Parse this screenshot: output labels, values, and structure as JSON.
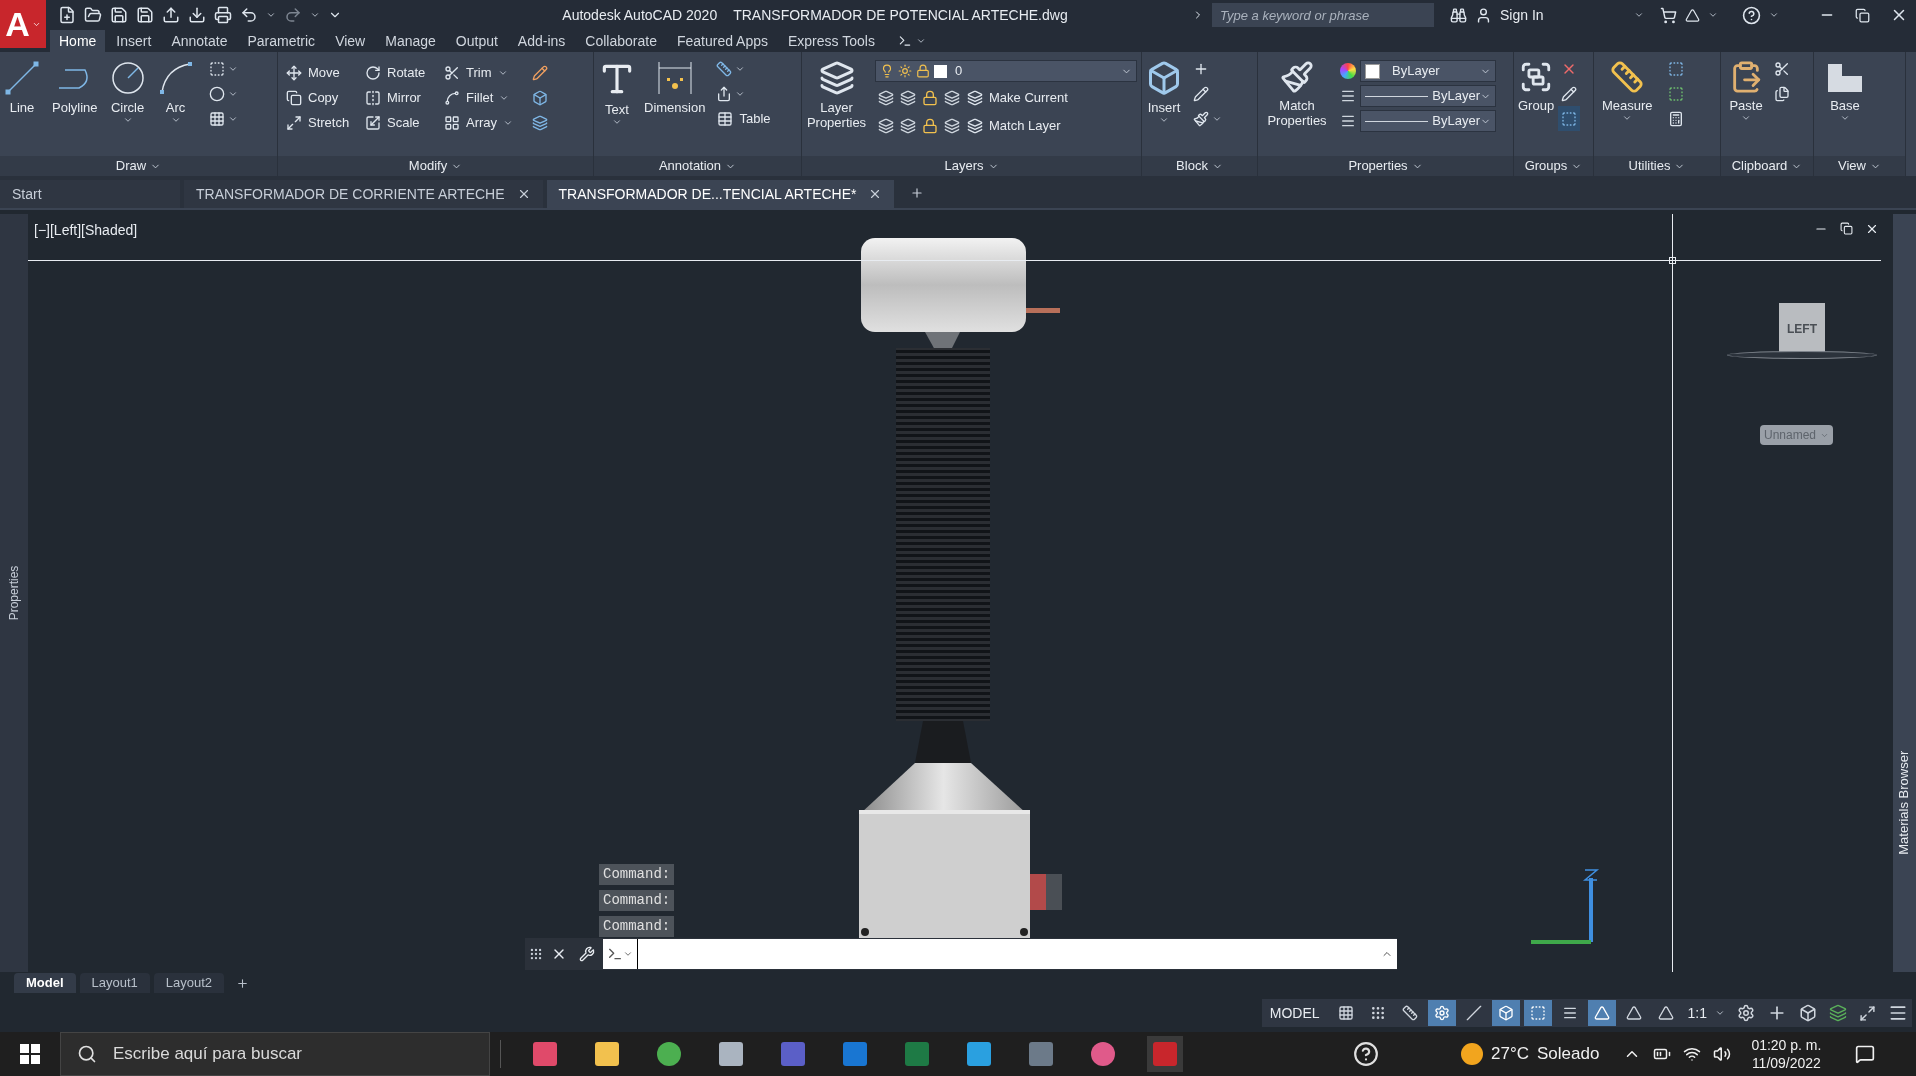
{
  "app_button": {
    "logo": "A"
  },
  "title_bar": {
    "app_title": "Autodesk AutoCAD 2020",
    "file_title": "TRANSFORMADOR DE POTENCIAL ARTECHE.dwg",
    "search": {
      "placeholder": "Type a keyword or phrase"
    },
    "sign_in": "Sign In"
  },
  "ribbon_tabs": [
    {
      "label": "Home",
      "selected": true
    },
    {
      "label": "Insert",
      "selected": false
    },
    {
      "label": "Annotate",
      "selected": false
    },
    {
      "label": "Parametric",
      "selected": false
    },
    {
      "label": "View",
      "selected": false
    },
    {
      "label": "Manage",
      "selected": false
    },
    {
      "label": "Output",
      "selected": false
    },
    {
      "label": "Add-ins",
      "selected": false
    },
    {
      "label": "Collaborate",
      "selected": false
    },
    {
      "label": "Featured Apps",
      "selected": false
    },
    {
      "label": "Express Tools",
      "selected": false
    }
  ],
  "ribbon_panels": [
    {
      "title": "Draw",
      "large": [
        "Line",
        "Polyline",
        "Circle",
        "Arc"
      ]
    },
    {
      "title": "Modify",
      "small": [
        "Move",
        "Rotate",
        "Trim",
        "Copy",
        "Mirror",
        "Fillet",
        "Stretch",
        "Scale",
        "Array"
      ]
    },
    {
      "title": "Annotation",
      "large": [
        "Text",
        "Dimension"
      ],
      "small": [
        "Table"
      ]
    },
    {
      "title": "Layers",
      "large": [
        "Layer Properties"
      ],
      "layer": "0",
      "small": [
        "Make Current",
        "Match Layer"
      ]
    },
    {
      "title": "Block",
      "large": [
        "Insert"
      ]
    },
    {
      "title": "Properties",
      "large": [
        "Match Properties"
      ],
      "dropdowns": [
        "ByLayer",
        "ByLayer",
        "ByLayer"
      ]
    },
    {
      "title": "Groups",
      "large": [
        "Group"
      ]
    },
    {
      "title": "Utilities",
      "large": [
        "Measure"
      ]
    },
    {
      "title": "Clipboard",
      "large": [
        "Paste"
      ]
    },
    {
      "title": "View",
      "large": [
        "Base"
      ]
    }
  ],
  "file_tabs": [
    {
      "label": "Start",
      "selected": false
    },
    {
      "label": "TRANSFORMADOR DE CORRIENTE ARTECHE",
      "selected": false
    },
    {
      "label": "TRANSFORMADOR DE...TENCIAL ARTECHE*",
      "selected": true
    }
  ],
  "left_palette": "Properties",
  "right_palette": "Materials Browser",
  "viewport": {
    "label": "[−][Left][Shaded]",
    "viewcube": "LEFT",
    "named_view": "Unnamed"
  },
  "command_history": [
    "Command:",
    "Command:",
    "Command:"
  ],
  "layout_tabs": [
    {
      "label": "Model",
      "selected": true
    },
    {
      "label": "Layout1",
      "selected": false
    },
    {
      "label": "Layout2",
      "selected": false
    }
  ],
  "status_bar": {
    "space": "MODEL",
    "scale": "1:1",
    "toggles": [
      {
        "on": false
      },
      {
        "on": false
      },
      {
        "on": false
      },
      {
        "on": true
      },
      {
        "on": false
      },
      {
        "on": true
      },
      {
        "on": true
      },
      {
        "on": false
      },
      {
        "on": true
      },
      {
        "on": false
      },
      {
        "on": false
      }
    ]
  },
  "taskbar": {
    "search": {
      "placeholder": "Escribe aquí para buscar"
    },
    "temperature": "27°C",
    "weather": "Soleado",
    "time": "01:20 p. m.",
    "date": "11/09/2022"
  }
}
